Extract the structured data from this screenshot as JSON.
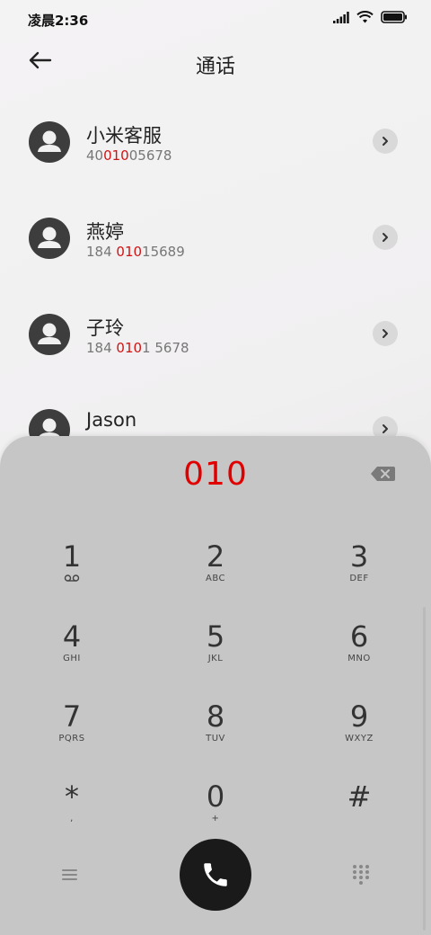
{
  "status_bar": {
    "time": "凌晨2:36"
  },
  "header": {
    "title": "通话"
  },
  "contacts": [
    {
      "name": "小米客服",
      "number_pre": "40",
      "number_hl": "010",
      "number_post": "05678"
    },
    {
      "name": "燕婷",
      "number_pre": "184 ",
      "number_hl": "010",
      "number_post": "15689"
    },
    {
      "name": "子玲",
      "number_pre": "184 ",
      "number_hl": "010",
      "number_post": "1 5678"
    },
    {
      "name": "Jason",
      "number_pre": "",
      "number_hl": "",
      "number_post": ""
    }
  ],
  "dialer": {
    "input": "010",
    "keys": [
      {
        "digit": "1",
        "letters": ""
      },
      {
        "digit": "2",
        "letters": "ABC"
      },
      {
        "digit": "3",
        "letters": "DEF"
      },
      {
        "digit": "4",
        "letters": "GHI"
      },
      {
        "digit": "5",
        "letters": "JKL"
      },
      {
        "digit": "6",
        "letters": "MNO"
      },
      {
        "digit": "7",
        "letters": "PQRS"
      },
      {
        "digit": "8",
        "letters": "TUV"
      },
      {
        "digit": "9",
        "letters": "WXYZ"
      },
      {
        "digit": "*",
        "letters": ","
      },
      {
        "digit": "0",
        "letters": "+"
      },
      {
        "digit": "#",
        "letters": ""
      }
    ]
  },
  "icons": {
    "back": "arrow-left-icon",
    "detail": "chevron-right-icon",
    "backspace": "backspace-icon",
    "voicemail": "voicemail-icon",
    "menu": "menu-icon",
    "call": "phone-icon",
    "keypad": "dialpad-icon"
  },
  "colors": {
    "highlight": "#d21414",
    "dial_input": "#e00000",
    "dialer_bg": "#c6c6c6",
    "call_button": "#1a1a1a"
  }
}
